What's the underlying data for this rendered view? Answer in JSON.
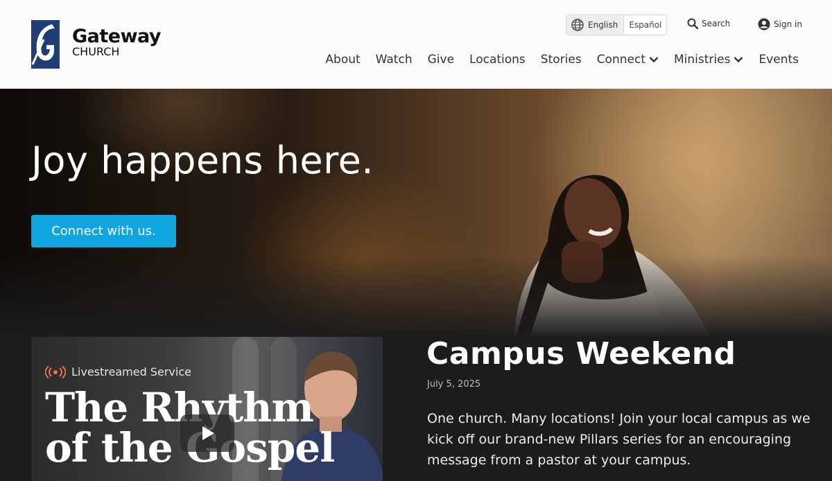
{
  "header": {
    "logo_name": "Gateway",
    "logo_sub": "CHURCH",
    "language": {
      "active": "English",
      "alternate": "Español"
    },
    "search_label": "Search",
    "signin_label": "Sign in",
    "nav": [
      {
        "label": "About",
        "has_dropdown": false
      },
      {
        "label": "Watch",
        "has_dropdown": false
      },
      {
        "label": "Give",
        "has_dropdown": false
      },
      {
        "label": "Locations",
        "has_dropdown": false
      },
      {
        "label": "Stories",
        "has_dropdown": false
      },
      {
        "label": "Connect",
        "has_dropdown": true
      },
      {
        "label": "Ministries",
        "has_dropdown": true
      },
      {
        "label": "Events",
        "has_dropdown": false
      }
    ]
  },
  "hero": {
    "title": "Joy happens here.",
    "cta_label": "Connect with us.",
    "cta_color": "#10a5e0"
  },
  "feature": {
    "video": {
      "badge": "Livestreamed Service",
      "series_line1": "The Rhythm",
      "series_line2": "of the Gospel",
      "play_icon": "play-icon"
    },
    "title": "Campus Weekend",
    "date": "July 5, 2025",
    "description": "One church. Many locations! Join your local campus as we kick off our brand-new Pillars series for an encouraging message from a pastor at your campus."
  },
  "colors": {
    "logo_blue": "#1f3e74",
    "live_orange": "#e8734a",
    "band_background": "#1c1c1c"
  }
}
